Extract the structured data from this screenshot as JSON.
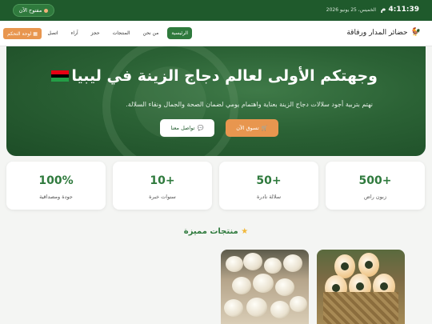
{
  "topbar": {
    "clock": "4:11:39 م",
    "date": "الخميس، 25 يونيو 2026",
    "open_label": "مفتوح الآن"
  },
  "nav": {
    "brand": "حضائر المدار ورفاقة",
    "links": [
      "الرئيسية",
      "من نحن",
      "المنتجات",
      "حجز",
      "آراء",
      "اتصل"
    ],
    "dashboard_label": "لوحة التحكم"
  },
  "hero": {
    "title": "وجهتكم الأولى لعالم دجاج الزينة في ليبيا",
    "subtitle": "نهتم بتربية أجود سلالات دجاج الزينة بعناية واهتمام يومي لضمان الصحة والجمال ونقاء السلالة.",
    "shop_button": "تسوق الآن",
    "contact_button": "تواصل معنا"
  },
  "stats": [
    {
      "number": "500+",
      "label": "زبون راض"
    },
    {
      "number": "50+",
      "label": "سلالة نادرة"
    },
    {
      "number": "10+",
      "label": "سنوات خبرة"
    },
    {
      "number": "100%",
      "label": "جودة ومصداقية"
    }
  ],
  "section": {
    "title": "منتجات مميزة"
  },
  "colors": {
    "primary_green": "#2f7a3d",
    "dark_green": "#1f5a2c",
    "accent_orange": "#e8964f"
  },
  "icons": [
    "rooster-icon",
    "flag-libya-icon",
    "cart-icon",
    "chat-icon",
    "star-icon",
    "dashboard-icon"
  ]
}
